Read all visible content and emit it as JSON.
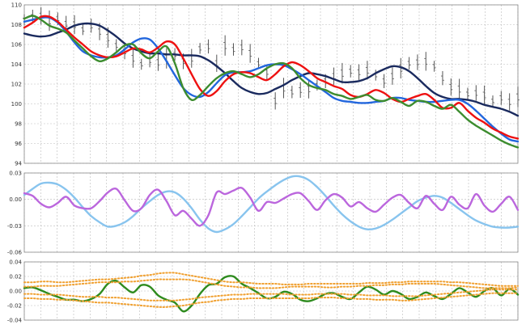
{
  "colors": {
    "grid": "#bbbbbb",
    "frame": "#888888",
    "price_bars": "#555555",
    "series_red": "#ee1111",
    "series_navy": "#1a2a5e",
    "series_blue": "#2266dd",
    "series_green_top": "#3c8c2e",
    "series_purple": "#bb66dd",
    "series_lightblue": "#88c4ee",
    "series_green_bottom": "#2e8b1e",
    "series_orange": "#f0a030"
  },
  "chart_data": [
    {
      "type": "line",
      "panel": "price",
      "ylim": [
        94,
        110
      ],
      "yticks": [
        "94",
        "96",
        "98",
        "100",
        "102",
        "104",
        "106",
        "108",
        "110"
      ],
      "x_count": 60,
      "price_bars": [
        108.5,
        108.8,
        108.9,
        108.4,
        108.6,
        108.1,
        108.0,
        107.5,
        107.9,
        107.3,
        106.7,
        105.9,
        105.3,
        104.6,
        104.0,
        104.4,
        104.2,
        104.6,
        105.0,
        104.3,
        104.6,
        105.6,
        105.8,
        104.1,
        105.9,
        105.5,
        105.7,
        105.1,
        104.1,
        103.2,
        100.3,
        101.6,
        101.2,
        101.4,
        101.5,
        101.9,
        102.3,
        102.8,
        103.1,
        103.3,
        103.2,
        103.4,
        102.9,
        102.3,
        102.8,
        103.6,
        104.1,
        104.2,
        104.3,
        103.8,
        102.6,
        101.7,
        101.5,
        101.0,
        101.1,
        100.9,
        100.3,
        100.6,
        100.2,
        100.7
      ],
      "series": [
        {
          "color_key": "series_navy",
          "values": [
            107.1,
            106.9,
            106.8,
            106.9,
            107.2,
            107.5,
            107.9,
            108.1,
            108.1,
            107.9,
            107.4,
            106.8,
            106.1,
            105.6,
            105.3,
            105.1,
            105.1,
            105.0,
            105.0,
            104.9,
            104.9,
            104.8,
            104.4,
            103.8,
            103.1,
            102.3,
            101.6,
            101.2,
            101.0,
            101.1,
            101.5,
            101.9,
            102.4,
            102.8,
            103.1,
            103.0,
            102.8,
            102.5,
            102.2,
            102.2,
            102.3,
            102.6,
            103.1,
            103.5,
            103.8,
            103.7,
            103.3,
            102.6,
            101.8,
            101.1,
            100.7,
            100.5,
            100.5,
            100.4,
            100.2,
            99.9,
            99.7,
            99.5,
            99.2,
            98.8
          ]
        },
        {
          "color_key": "series_blue",
          "values": [
            108.3,
            108.5,
            108.7,
            108.7,
            108.2,
            107.3,
            106.2,
            105.3,
            104.9,
            104.7,
            104.7,
            104.9,
            105.5,
            106.2,
            106.6,
            106.5,
            105.6,
            104.3,
            102.9,
            101.6,
            100.9,
            100.7,
            101.2,
            102.1,
            102.9,
            103.2,
            103.2,
            103.3,
            103.6,
            103.9,
            104.0,
            103.9,
            103.5,
            103.0,
            102.4,
            101.8,
            101.2,
            100.6,
            100.3,
            100.2,
            100.1,
            100.1,
            100.2,
            100.3,
            100.6,
            100.6,
            100.4,
            100.3,
            100.2,
            100.2,
            100.3,
            100.4,
            100.4,
            100.0,
            99.3,
            98.5,
            97.7,
            97.0,
            96.4,
            96.2
          ]
        },
        {
          "color_key": "series_red",
          "values": [
            107.7,
            108.2,
            108.8,
            108.8,
            108.3,
            107.5,
            106.7,
            106.0,
            105.3,
            104.9,
            104.7,
            104.8,
            105.2,
            105.6,
            105.5,
            105.2,
            105.7,
            106.3,
            106.0,
            104.6,
            103.0,
            101.5,
            100.8,
            101.3,
            102.3,
            103.0,
            103.2,
            103.1,
            102.7,
            102.4,
            103.0,
            103.8,
            104.2,
            103.9,
            103.3,
            102.6,
            102.2,
            101.8,
            101.5,
            100.9,
            100.7,
            101.0,
            101.4,
            101.1,
            100.5,
            100.2,
            100.5,
            100.8,
            101.0,
            100.4,
            99.6,
            99.6,
            100.1,
            99.3,
            98.6,
            98.1,
            97.5,
            97.1,
            96.7,
            96.5
          ]
        },
        {
          "color_key": "series_green_top",
          "values": [
            108.6,
            108.9,
            108.5,
            107.9,
            107.6,
            107.2,
            106.4,
            105.6,
            104.8,
            104.3,
            104.6,
            105.2,
            105.9,
            106.0,
            105.1,
            104.6,
            105.3,
            105.8,
            104.1,
            101.6,
            100.4,
            100.9,
            101.8,
            102.6,
            103.1,
            103.3,
            103.0,
            102.7,
            103.0,
            103.6,
            104.0,
            104.1,
            103.6,
            102.6,
            101.9,
            101.6,
            101.4,
            101.0,
            100.8,
            100.5,
            100.7,
            100.9,
            100.4,
            100.3,
            100.6,
            100.2,
            99.8,
            100.3,
            100.2,
            99.8,
            99.5,
            99.9,
            99.2,
            98.4,
            97.8,
            97.3,
            96.8,
            96.3,
            95.9,
            95.6
          ]
        }
      ]
    },
    {
      "type": "line",
      "panel": "oscillator",
      "ylim": [
        -0.06,
        0.03
      ],
      "yticks": [
        "0.03",
        "0.00",
        "-0.03",
        "-0.06"
      ],
      "x_count": 60,
      "series": [
        {
          "color_key": "series_lightblue",
          "values": [
            0.005,
            0.012,
            0.018,
            0.019,
            0.017,
            0.011,
            0.002,
            -0.009,
            -0.019,
            -0.026,
            -0.031,
            -0.03,
            -0.026,
            -0.019,
            -0.01,
            -0.002,
            0.005,
            0.009,
            0.008,
            0.001,
            -0.01,
            -0.023,
            -0.033,
            -0.037,
            -0.034,
            -0.028,
            -0.019,
            -0.009,
            0.001,
            0.009,
            0.016,
            0.022,
            0.026,
            0.026,
            0.022,
            0.014,
            0.004,
            -0.007,
            -0.017,
            -0.025,
            -0.031,
            -0.034,
            -0.033,
            -0.029,
            -0.023,
            -0.016,
            -0.009,
            -0.002,
            0.002,
            0.004,
            0.002,
            -0.004,
            -0.011,
            -0.018,
            -0.024,
            -0.028,
            -0.031,
            -0.032,
            -0.032,
            -0.031
          ]
        },
        {
          "color_key": "series_purple",
          "values": [
            0.007,
            0.004,
            -0.005,
            -0.009,
            -0.004,
            0.003,
            -0.007,
            -0.01,
            -0.01,
            -0.002,
            0.008,
            0.012,
            -0.001,
            -0.013,
            -0.01,
            0.005,
            0.011,
            -0.002,
            -0.018,
            -0.013,
            -0.022,
            -0.03,
            -0.018,
            0.008,
            0.006,
            0.01,
            0.013,
            0.002,
            -0.013,
            -0.003,
            -0.004,
            0.001,
            0.006,
            0.007,
            -0.002,
            -0.012,
            -0.001,
            0.006,
            0.002,
            -0.008,
            -0.003,
            -0.01,
            -0.014,
            -0.006,
            0.002,
            0.005,
            -0.004,
            -0.01,
            0.004,
            -0.005,
            -0.012,
            0.003,
            -0.006,
            -0.01,
            0.006,
            -0.007,
            -0.014,
            -0.005,
            0.003,
            -0.012
          ]
        }
      ]
    },
    {
      "type": "line",
      "panel": "noise",
      "ylim": [
        -0.04,
        0.04
      ],
      "yticks": [
        "0.04",
        "0.02",
        "0.00",
        "-0.02",
        "-0.04"
      ],
      "x_count": 60,
      "series": [
        {
          "color_key": "series_green_bottom",
          "values": [
            0.004,
            0.005,
            0.001,
            -0.004,
            -0.008,
            -0.012,
            -0.012,
            -0.014,
            -0.011,
            -0.004,
            0.01,
            0.014,
            0.005,
            -0.002,
            0.008,
            0.006,
            -0.006,
            -0.012,
            -0.016,
            -0.028,
            -0.02,
            -0.004,
            0.008,
            0.01,
            0.019,
            0.02,
            0.01,
            0.004,
            -0.003,
            -0.01,
            -0.008,
            -0.001,
            -0.004,
            -0.012,
            -0.014,
            -0.01,
            -0.004,
            -0.003,
            -0.008,
            -0.011,
            -0.002,
            0.006,
            0.002,
            -0.005,
            0.0,
            -0.004,
            -0.011,
            -0.008,
            -0.002,
            -0.007,
            -0.011,
            -0.004,
            0.004,
            -0.002,
            -0.008,
            0.0,
            0.004,
            -0.006,
            0.003,
            -0.005
          ]
        },
        {
          "color_key": "series_orange",
          "values": [
            0.012,
            0.012,
            0.013,
            0.013,
            0.012,
            0.012,
            0.013,
            0.014,
            0.015,
            0.016,
            0.016,
            0.017,
            0.018,
            0.019,
            0.021,
            0.022,
            0.024,
            0.025,
            0.025,
            0.023,
            0.021,
            0.019,
            0.017,
            0.015,
            0.013,
            0.012,
            0.012,
            0.011,
            0.01,
            0.01,
            0.01,
            0.009,
            0.009,
            0.009,
            0.01,
            0.01,
            0.01,
            0.01,
            0.01,
            0.01,
            0.01,
            0.011,
            0.011,
            0.011,
            0.012,
            0.012,
            0.013,
            0.013,
            0.013,
            0.013,
            0.013,
            0.012,
            0.012,
            0.011,
            0.01,
            0.009,
            0.008,
            0.007,
            0.007,
            0.007
          ]
        },
        {
          "color_key": "series_orange",
          "values": [
            0.006,
            0.006,
            0.007,
            0.007,
            0.007,
            0.008,
            0.009,
            0.01,
            0.011,
            0.012,
            0.012,
            0.012,
            0.013,
            0.013,
            0.014,
            0.015,
            0.016,
            0.016,
            0.016,
            0.016,
            0.015,
            0.013,
            0.011,
            0.009,
            0.007,
            0.006,
            0.005,
            0.005,
            0.004,
            0.004,
            0.004,
            0.005,
            0.006,
            0.006,
            0.006,
            0.006,
            0.005,
            0.005,
            0.006,
            0.006,
            0.007,
            0.007,
            0.008,
            0.008,
            0.009,
            0.009,
            0.01,
            0.01,
            0.01,
            0.01,
            0.009,
            0.008,
            0.007,
            0.006,
            0.005,
            0.004,
            0.004,
            0.004,
            0.004,
            0.005
          ]
        },
        {
          "color_key": "series_orange",
          "values": [
            -0.004,
            -0.004,
            -0.005,
            -0.005,
            -0.005,
            -0.006,
            -0.007,
            -0.008,
            -0.008,
            -0.008,
            -0.009,
            -0.009,
            -0.01,
            -0.011,
            -0.012,
            -0.013,
            -0.013,
            -0.013,
            -0.013,
            -0.012,
            -0.011,
            -0.009,
            -0.008,
            -0.007,
            -0.006,
            -0.005,
            -0.005,
            -0.004,
            -0.004,
            -0.004,
            -0.004,
            -0.004,
            -0.005,
            -0.005,
            -0.005,
            -0.004,
            -0.004,
            -0.004,
            -0.004,
            -0.005,
            -0.005,
            -0.006,
            -0.006,
            -0.006,
            -0.007,
            -0.007,
            -0.007,
            -0.007,
            -0.006,
            -0.005,
            -0.004,
            -0.003,
            -0.002,
            -0.001,
            0.0,
            0.001,
            0.002,
            0.002,
            0.002,
            0.002
          ]
        },
        {
          "color_key": "series_orange",
          "values": [
            -0.01,
            -0.01,
            -0.011,
            -0.011,
            -0.012,
            -0.012,
            -0.013,
            -0.014,
            -0.015,
            -0.016,
            -0.016,
            -0.017,
            -0.018,
            -0.019,
            -0.02,
            -0.021,
            -0.022,
            -0.022,
            -0.021,
            -0.02,
            -0.018,
            -0.016,
            -0.015,
            -0.013,
            -0.012,
            -0.011,
            -0.011,
            -0.01,
            -0.01,
            -0.01,
            -0.01,
            -0.01,
            -0.01,
            -0.01,
            -0.01,
            -0.009,
            -0.009,
            -0.009,
            -0.01,
            -0.01,
            -0.011,
            -0.011,
            -0.012,
            -0.012,
            -0.012,
            -0.013,
            -0.013,
            -0.012,
            -0.011,
            -0.01,
            -0.009,
            -0.008,
            -0.007,
            -0.006,
            -0.005,
            -0.004,
            -0.003,
            -0.003,
            -0.003,
            -0.003
          ]
        }
      ]
    }
  ]
}
